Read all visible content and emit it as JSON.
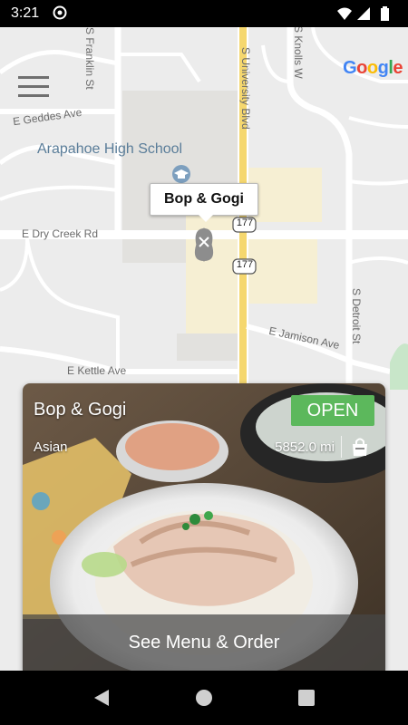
{
  "status_bar": {
    "time": "3:21",
    "icons": [
      "app-notification-icon",
      "wifi-icon",
      "signal-icon",
      "battery-icon"
    ]
  },
  "map": {
    "logo": [
      "G",
      "o",
      "o",
      "g",
      "l",
      "e"
    ],
    "logo_colors": [
      "#4285F4",
      "#EA4335",
      "#FBBC05",
      "#4285F4",
      "#34A853",
      "#EA4335"
    ],
    "streets": {
      "franklin": "S Franklin St",
      "university": "S University Blvd",
      "knolls": "S Knolls W",
      "geddes": "E Geddes Ave",
      "dry_creek": "E Dry Creek Rd",
      "detroit": "S Detroit St",
      "jamison": "E Jamison Ave",
      "kettle": "E Kettle Ave"
    },
    "school": "Arapahoe High School",
    "route_shield_1": "177",
    "route_shield_2": "177",
    "marker_label": "Bop & Gogi"
  },
  "card": {
    "name": "Bop & Gogi",
    "status": "OPEN",
    "status_color": "#5cb85c",
    "cuisine": "Asian",
    "distance": "5852.0 mi",
    "cta": "See Menu & Order"
  }
}
